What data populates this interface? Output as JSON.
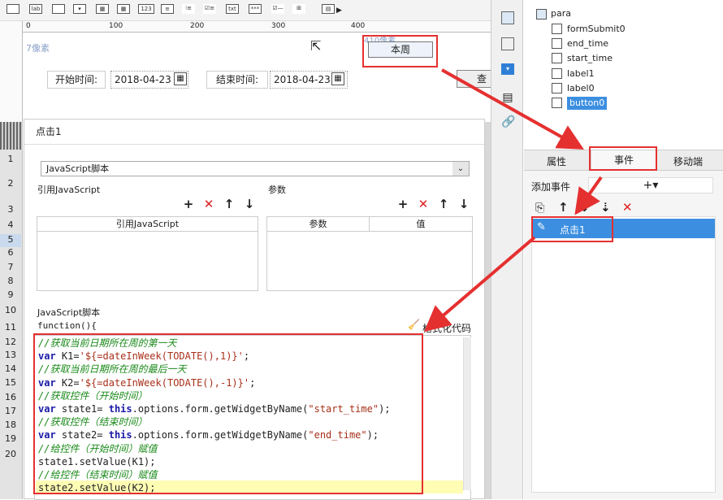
{
  "toolbar": {
    "icons": [
      "label-icon",
      "textbox-icon",
      "combobox-icon",
      "date-icon",
      "grid-icon",
      "number-icon",
      "textarea-icon",
      "radio-icon",
      "checkbox-icon",
      "text-icon",
      "password-icon",
      "checkbox-group-icon",
      "tree-icon",
      "report-icon",
      "more-icon"
    ],
    "icon_texts": {
      "label": "lab",
      "number": "123",
      "text": "txt",
      "password": "***"
    }
  },
  "ruler": {
    "ticks": [
      "0",
      "100",
      "200",
      "300",
      "400"
    ]
  },
  "canvas": {
    "pixel_hint": "7像素",
    "pixel_hint2": "410像素",
    "button_label": "本周",
    "start_label": "开始时间:",
    "start_value": "2018-04-23",
    "end_label": "结束时间:",
    "end_value": "2018-04-23",
    "query_label": "查询"
  },
  "dialog": {
    "title": "点击1",
    "script_type": "JavaScript脚本",
    "ref_js_label": "引用JavaScript",
    "params_label": "参数",
    "ref_js_col": "引用JavaScript",
    "param_col": "参数",
    "value_col": "值",
    "script_label": "JavaScript脚本",
    "function_head": "function(){",
    "format_label": "格式化代码"
  },
  "row_numbers": [
    "1",
    "2",
    "3",
    "4",
    "5",
    "6",
    "7",
    "8",
    "9",
    "10",
    "11",
    "12",
    "13",
    "14",
    "15",
    "16",
    "17",
    "18",
    "19",
    "20"
  ],
  "code": [
    {
      "type": "comment",
      "text": "//获取当前日期所在周的第一天"
    },
    {
      "type": "code",
      "kw": "var",
      "text": " K1=",
      "str": "'${=dateInWeek(TODATE(),1)}'",
      "tail": ";"
    },
    {
      "type": "comment",
      "text": "//获取当前日期所在周的最后一天"
    },
    {
      "type": "code",
      "kw": "var",
      "text": " K2=",
      "str": "'${=dateInWeek(TODATE(),-1)}'",
      "tail": ";"
    },
    {
      "type": "comment",
      "text": "//获取控件（开始时间）"
    },
    {
      "type": "code2",
      "kw": "var",
      "text": " state1= ",
      "kw2": "this",
      "text2": ".options.form.getWidgetByName(",
      "str": "\"start_time\"",
      "tail": ");"
    },
    {
      "type": "comment",
      "text": "//获取控件（结束时间）"
    },
    {
      "type": "code2",
      "kw": "var",
      "text": " state2= ",
      "kw2": "this",
      "text2": ".options.form.getWidgetByName(",
      "str": "\"end_time\"",
      "tail": ");"
    },
    {
      "type": "comment",
      "text": "//给控件（开始时间）赋值"
    },
    {
      "type": "plain",
      "text": "state1.setValue(K1);"
    },
    {
      "type": "comment",
      "text": "//给控件（结束时间）赋值"
    },
    {
      "type": "plain",
      "text": "state2.setValue(K2);"
    }
  ],
  "tree": {
    "root": "para",
    "items": [
      {
        "label": "formSubmit0",
        "icon": "form-submit-icon"
      },
      {
        "label": "end_time",
        "icon": "date-widget-icon"
      },
      {
        "label": "start_time",
        "icon": "date-widget-icon"
      },
      {
        "label": "label1",
        "icon": "label-widget-icon"
      },
      {
        "label": "label0",
        "icon": "label-widget-icon"
      },
      {
        "label": "button0",
        "icon": "button-widget-icon"
      }
    ]
  },
  "tabs": [
    "属性",
    "事件",
    "移动端"
  ],
  "events": {
    "add_label": "添加事件",
    "add_symbol": "+▾",
    "item": "点击1"
  },
  "colors": {
    "highlight": "#e53030",
    "selection": "#3c8fe0",
    "tab_active": "#f5f5f5"
  }
}
